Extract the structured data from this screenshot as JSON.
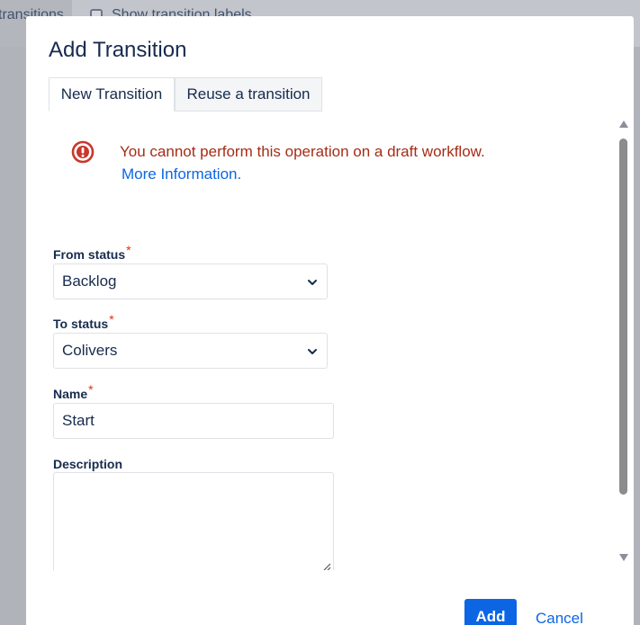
{
  "background": {
    "tab_label": "transitions",
    "checkbox_label": "Show transition labels"
  },
  "dialog": {
    "title": "Add Transition",
    "tabs": [
      {
        "label": "New Transition",
        "active": true
      },
      {
        "label": "Reuse a transition",
        "active": false
      }
    ],
    "error": {
      "message": "You cannot perform this operation on a draft workflow.",
      "link": "More Information."
    },
    "form": {
      "from_status": {
        "label": "From status",
        "required_mark": "*",
        "value": "Backlog"
      },
      "to_status": {
        "label": "To status",
        "required_mark": "*",
        "value": "Colivers"
      },
      "name": {
        "label": "Name",
        "required_mark": "*",
        "value": "Start"
      },
      "description": {
        "label": "Description",
        "value": ""
      }
    },
    "buttons": {
      "add": "Add",
      "cancel": "Cancel"
    }
  },
  "colors": {
    "primary": "#0c66e4",
    "error": "#a52d16",
    "required": "#de350b",
    "text": "#172b4d"
  }
}
